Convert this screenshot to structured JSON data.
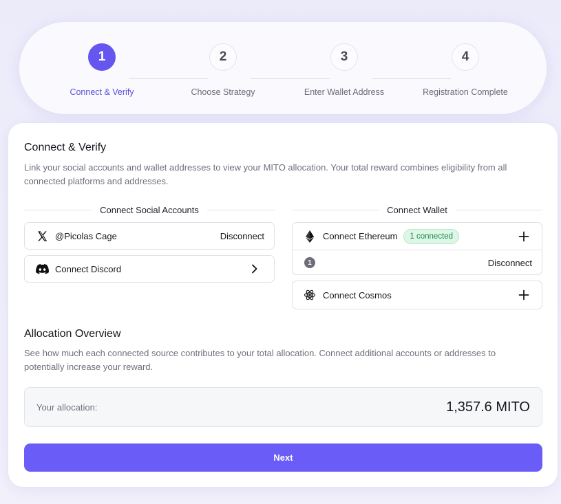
{
  "stepper": {
    "steps": [
      {
        "number": "1",
        "label": "Connect & Verify",
        "active": true
      },
      {
        "number": "2",
        "label": "Choose Strategy",
        "active": false
      },
      {
        "number": "3",
        "label": "Enter Wallet Address",
        "active": false
      },
      {
        "number": "4",
        "label": "Registration Complete",
        "active": false
      }
    ]
  },
  "connect": {
    "title": "Connect & Verify",
    "description": "Link your social accounts and wallet addresses to view your MITO allocation. Your total reward combines eligibility from all connected platforms and addresses."
  },
  "social": {
    "heading": "Connect Social Accounts",
    "x_account": {
      "icon": "x-logo-icon",
      "label": "@Picolas Cage",
      "action": "Disconnect"
    },
    "discord": {
      "icon": "discord-icon",
      "label": "Connect Discord",
      "action_icon": "chevron-right-icon"
    }
  },
  "wallet": {
    "heading": "Connect Wallet",
    "ethereum": {
      "icon": "ethereum-icon",
      "label": "Connect Ethereum",
      "badge": "1 connected",
      "action_icon": "plus-icon",
      "entries": [
        {
          "index": "1",
          "action": "Disconnect"
        }
      ]
    },
    "cosmos": {
      "icon": "cosmos-icon",
      "label": "Connect Cosmos",
      "action_icon": "plus-icon"
    }
  },
  "allocation": {
    "title": "Allocation Overview",
    "description": "See how much each connected source contributes to your total allocation. Connect additional accounts or addresses to potentially increase your reward.",
    "label": "Your allocation:",
    "value": "1,357.6 MITO"
  },
  "next_button": {
    "label": "Next"
  },
  "colors": {
    "accent": "#6556f0",
    "button": "#6a5cf6",
    "badge_bg": "#ddf6e6",
    "badge_text": "#1c8a4e"
  }
}
